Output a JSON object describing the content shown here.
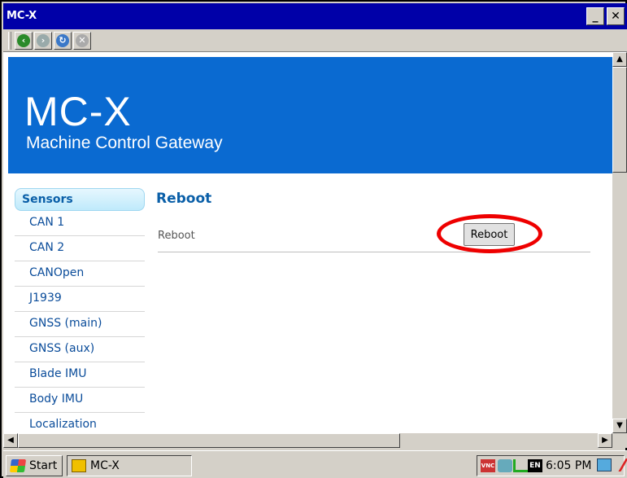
{
  "window": {
    "title": "MC-X",
    "minimize_glyph": "_",
    "close_glyph": "✕"
  },
  "toolbar": {
    "icons": [
      "back-icon",
      "forward-icon",
      "refresh-icon",
      "stop-icon"
    ]
  },
  "banner": {
    "title": "MC-X",
    "subtitle": "Machine Control Gateway"
  },
  "sidebar": {
    "active": "Sensors",
    "items": [
      "CAN 1",
      "CAN 2",
      "CANOpen",
      "J1939",
      "GNSS (main)",
      "GNSS (aux)",
      "Blade IMU",
      "Body IMU",
      "Localization"
    ]
  },
  "main": {
    "title": "Reboot",
    "row_label": "Reboot",
    "button_label": "Reboot"
  },
  "taskbar": {
    "start_label": "Start",
    "task_label": "MC-X",
    "tray": {
      "lang": "EN",
      "time": "6:05 PM",
      "vnc_badge": "VNC"
    }
  },
  "colors": {
    "banner": "#0a6ad1",
    "highlight_circle": "#e00000",
    "titlebar": "#0000a8"
  }
}
